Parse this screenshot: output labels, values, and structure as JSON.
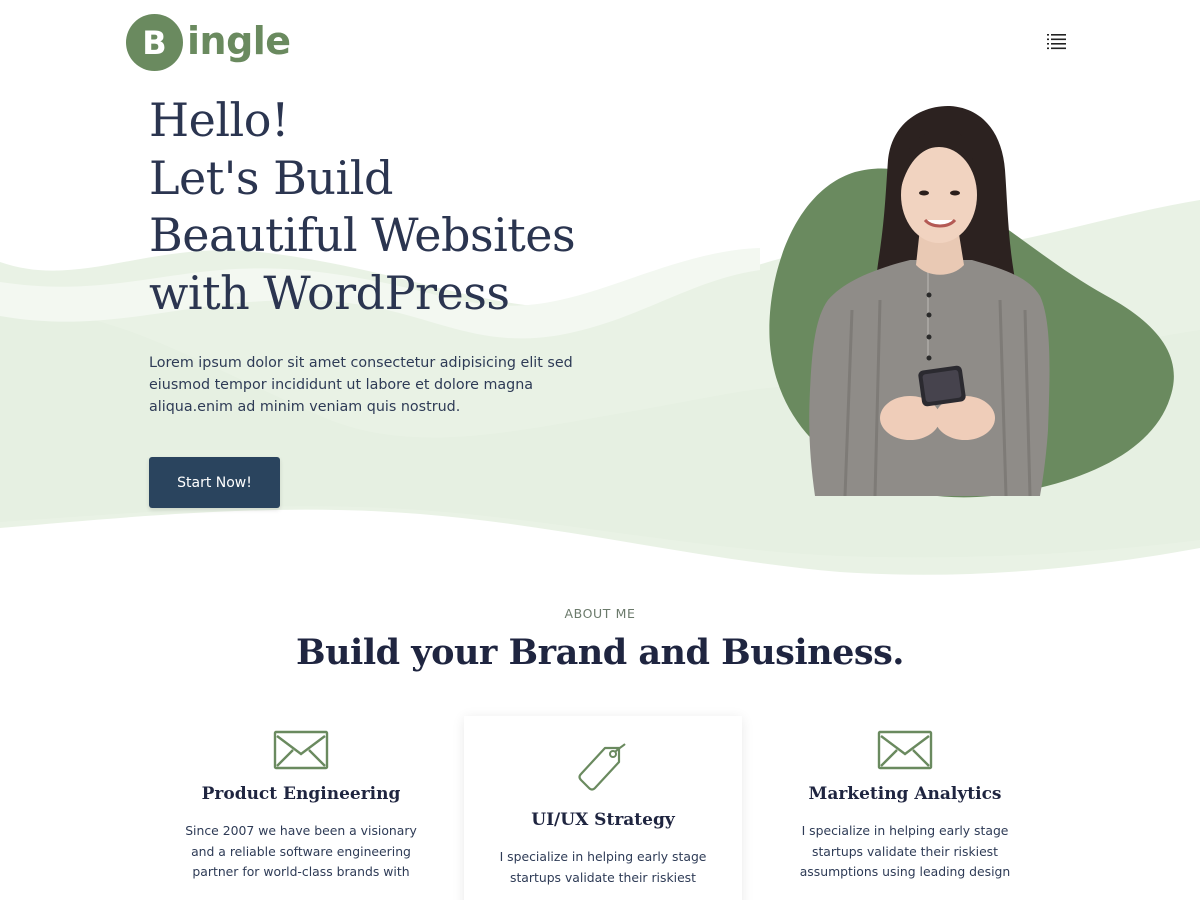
{
  "brand": {
    "logo_letter": "B",
    "logo_text": "ingle",
    "accent_color": "#6a8a5f",
    "navy_color": "#2a445e"
  },
  "header": {
    "menu_icon": "hamburger-menu-icon"
  },
  "hero": {
    "title_lines": [
      "Hello!",
      "Let's Build",
      "Beautiful Websites",
      "with WordPress"
    ],
    "description": "Lorem ipsum dolor sit amet consectetur adipisicing elit sed eiusmod tempor incididunt ut labore et dolore magna aliqua.enim ad minim veniam quis nostrud.",
    "cta_label": "Start Now!",
    "image": "smiling-woman-holding-smartphone"
  },
  "about": {
    "kicker": "ABOUT ME",
    "title": "Build your Brand and Business.",
    "cards": [
      {
        "icon": "envelope-icon",
        "title": "Product Engineering",
        "text": "Since 2007 we have been a visionary and a reliable software engineering partner for world-class brands with"
      },
      {
        "icon": "tag-icon",
        "title": "UI/UX Strategy",
        "text": "I specialize in helping early stage startups validate their riskiest"
      },
      {
        "icon": "envelope-icon",
        "title": "Marketing Analytics",
        "text": "I specialize in helping early stage startups validate their riskiest assumptions using leading design"
      }
    ]
  }
}
